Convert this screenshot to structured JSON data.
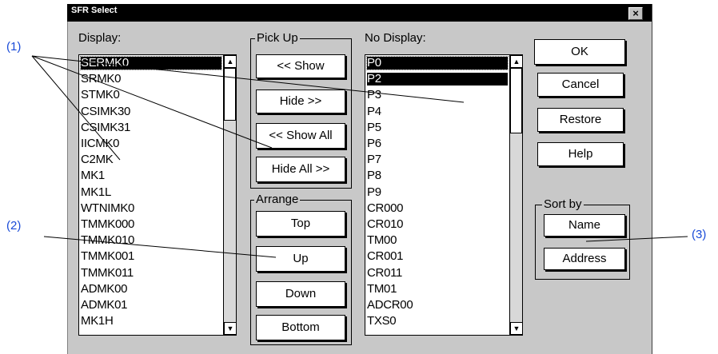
{
  "window": {
    "title": "SFR Select",
    "close_glyph": "×"
  },
  "display": {
    "label": "Display:",
    "items": [
      "SERMK0",
      "SRMK0",
      "STMK0",
      "CSIMK30",
      "CSIMK31",
      "IICMK0",
      "C2MK",
      "MK1",
      "MK1L",
      "WTNIMK0",
      "TMMK000",
      "TMMK010",
      "TMMK001",
      "TMMK011",
      "ADMK00",
      "ADMK01",
      "MK1H"
    ]
  },
  "pickup": {
    "label": "Pick Up",
    "show": "<< Show",
    "hide": "Hide >>",
    "show_all": "<< Show All",
    "hide_all": "Hide All >>"
  },
  "arrange": {
    "label": "Arrange",
    "top": "Top",
    "up": "Up",
    "down": "Down",
    "bottom": "Bottom"
  },
  "nodisplay": {
    "label": "No Display:",
    "items": [
      "P0",
      "P2",
      "P3",
      "P4",
      "P5",
      "P6",
      "P7",
      "P8",
      "P9",
      "CR000",
      "CR010",
      "TM00",
      "CR001",
      "CR011",
      "TM01",
      "ADCR00",
      "TXS0"
    ]
  },
  "actions": {
    "ok": "OK",
    "cancel": "Cancel",
    "restore": "Restore",
    "help": "Help"
  },
  "sortby": {
    "label": "Sort by",
    "name": "Name",
    "address": "Address"
  },
  "callouts": {
    "c1": "(1)",
    "c2": "(2)",
    "c3": "(3)"
  },
  "scroll": {
    "up_glyph": "▲",
    "down_glyph": "▼"
  }
}
